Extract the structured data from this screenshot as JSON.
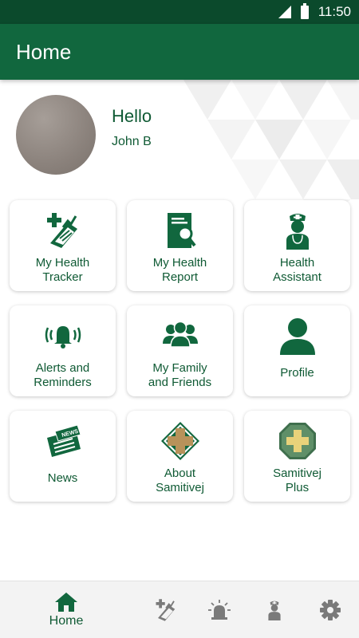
{
  "status_bar": {
    "time": "11:50"
  },
  "app_bar": {
    "title": "Home"
  },
  "profile": {
    "greeting": "Hello",
    "name": "John B"
  },
  "tiles": [
    {
      "label": "My Health\nTracker",
      "icon": "health-tracker-icon"
    },
    {
      "label": "My Health\nReport",
      "icon": "health-report-icon"
    },
    {
      "label": "Health\nAssistant",
      "icon": "nurse-icon"
    },
    {
      "label": "Alerts and\nReminders",
      "icon": "bell-icon"
    },
    {
      "label": "My Family\nand Friends",
      "icon": "family-icon"
    },
    {
      "label": "Profile",
      "icon": "person-icon"
    },
    {
      "label": "News",
      "icon": "newspaper-icon"
    },
    {
      "label": "About\nSamitivej",
      "icon": "samitivej-cross-icon"
    },
    {
      "label": "Samitivej\nPlus",
      "icon": "samitivej-plus-icon"
    }
  ],
  "bottom_nav": {
    "home_label": "Home",
    "items": [
      "home-icon",
      "health-tracker-icon",
      "alarm-icon",
      "nurse-icon",
      "gear-icon"
    ]
  },
  "colors": {
    "primary": "#11673e",
    "status_bar": "#0b4a2c",
    "text_green": "#0f5a34",
    "gold": "#b8925a"
  }
}
